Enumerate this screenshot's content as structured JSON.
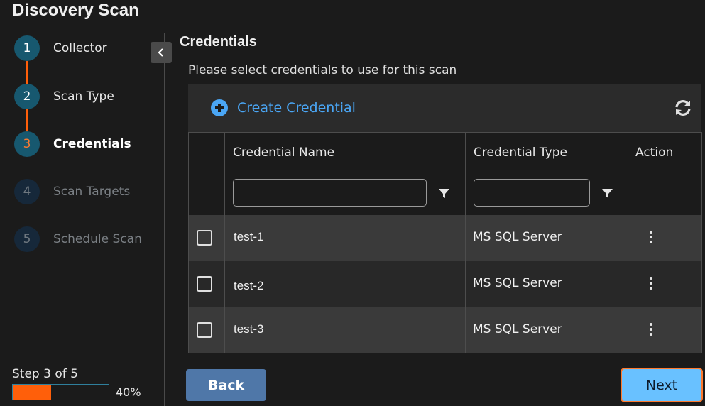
{
  "page": {
    "title": "Discovery Scan"
  },
  "stepper": {
    "steps": [
      {
        "number": "1",
        "label": "Collector",
        "state": "done"
      },
      {
        "number": "2",
        "label": "Scan Type",
        "state": "done"
      },
      {
        "number": "3",
        "label": "Credentials",
        "state": "current"
      },
      {
        "number": "4",
        "label": "Scan Targets",
        "state": "future"
      },
      {
        "number": "5",
        "label": "Schedule Scan",
        "state": "future"
      }
    ],
    "progress_label": "Step 3 of 5",
    "progress_percent_text": "40%",
    "progress_fraction": 0.4
  },
  "main": {
    "section_title": "Credentials",
    "instructions": "Please select credentials to use for this scan",
    "create_label": "Create Credential",
    "table": {
      "columns": [
        "Credential Name",
        "Credential Type",
        "Action"
      ],
      "filters": {
        "name": "",
        "type": ""
      },
      "rows": [
        {
          "name": "test-1",
          "type": "MS SQL Server"
        },
        {
          "name": "test-2",
          "type": "MS SQL Server"
        },
        {
          "name": "test-3",
          "type": "MS SQL Server"
        }
      ]
    }
  },
  "footer": {
    "back_label": "Back",
    "next_label": "Next"
  },
  "colors": {
    "accent_orange": "#ff5f0a",
    "link_blue": "#4aa6f5",
    "next_button": "#69c1ff",
    "back_button": "#4f77a8"
  },
  "icons": {
    "create": "plus-circle-icon",
    "refresh": "refresh-icon",
    "filter": "filter-icon",
    "action": "kebab-menu-icon",
    "collapse": "chevron-left-icon"
  }
}
